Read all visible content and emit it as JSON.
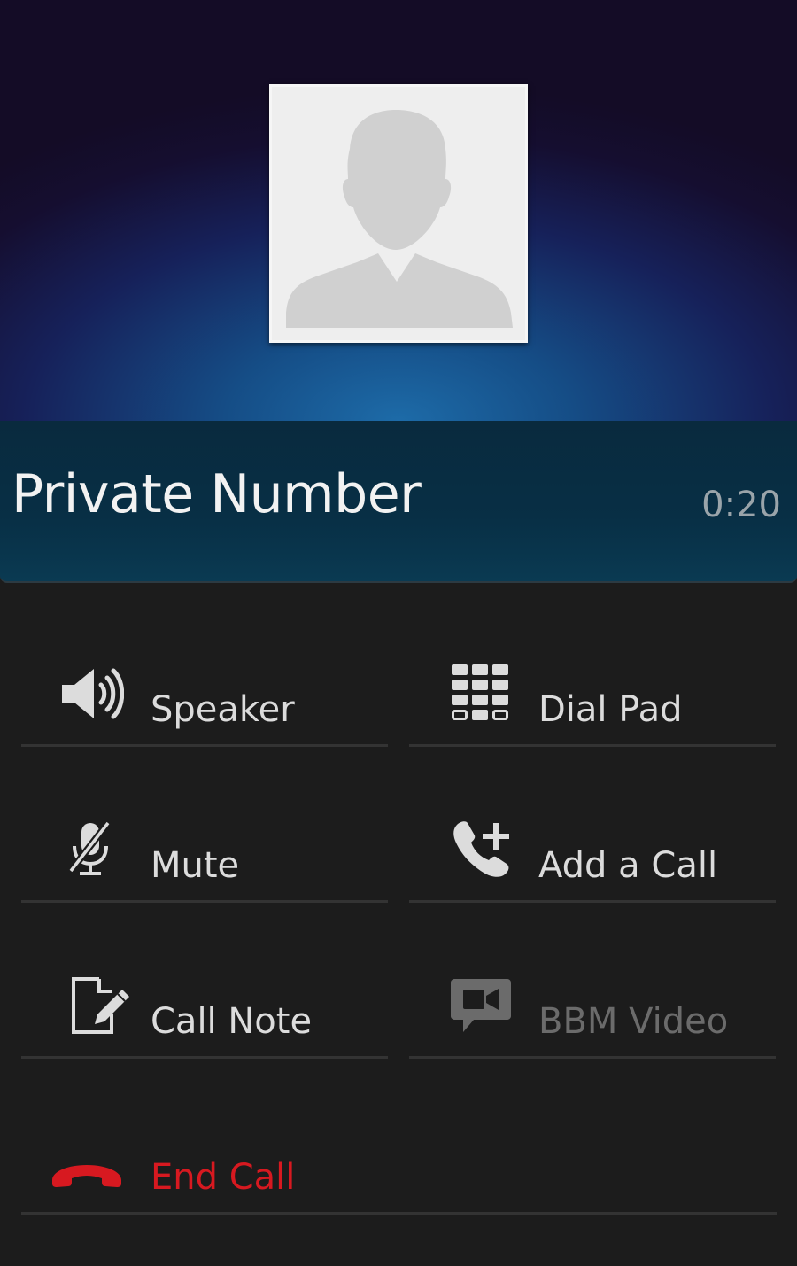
{
  "caller": {
    "name": "Private Number",
    "duration": "0:20"
  },
  "actions": {
    "speaker": {
      "label": "Speaker",
      "icon": "speaker-icon"
    },
    "dial_pad": {
      "label": "Dial Pad",
      "icon": "dial-pad-icon"
    },
    "mute": {
      "label": "Mute",
      "icon": "mute-icon"
    },
    "add_call": {
      "label": "Add a Call",
      "icon": "add-call-icon"
    },
    "call_note": {
      "label": "Call Note",
      "icon": "call-note-icon"
    },
    "bbm_video": {
      "label": "BBM Video",
      "icon": "bbm-video-icon",
      "enabled": false
    },
    "end_call": {
      "label": "End Call",
      "icon": "end-call-icon"
    }
  },
  "colors": {
    "end_call": "#d71920",
    "disabled_text": "#6b6b6b",
    "text": "#dcdcdc",
    "background": "#1c1c1c"
  }
}
